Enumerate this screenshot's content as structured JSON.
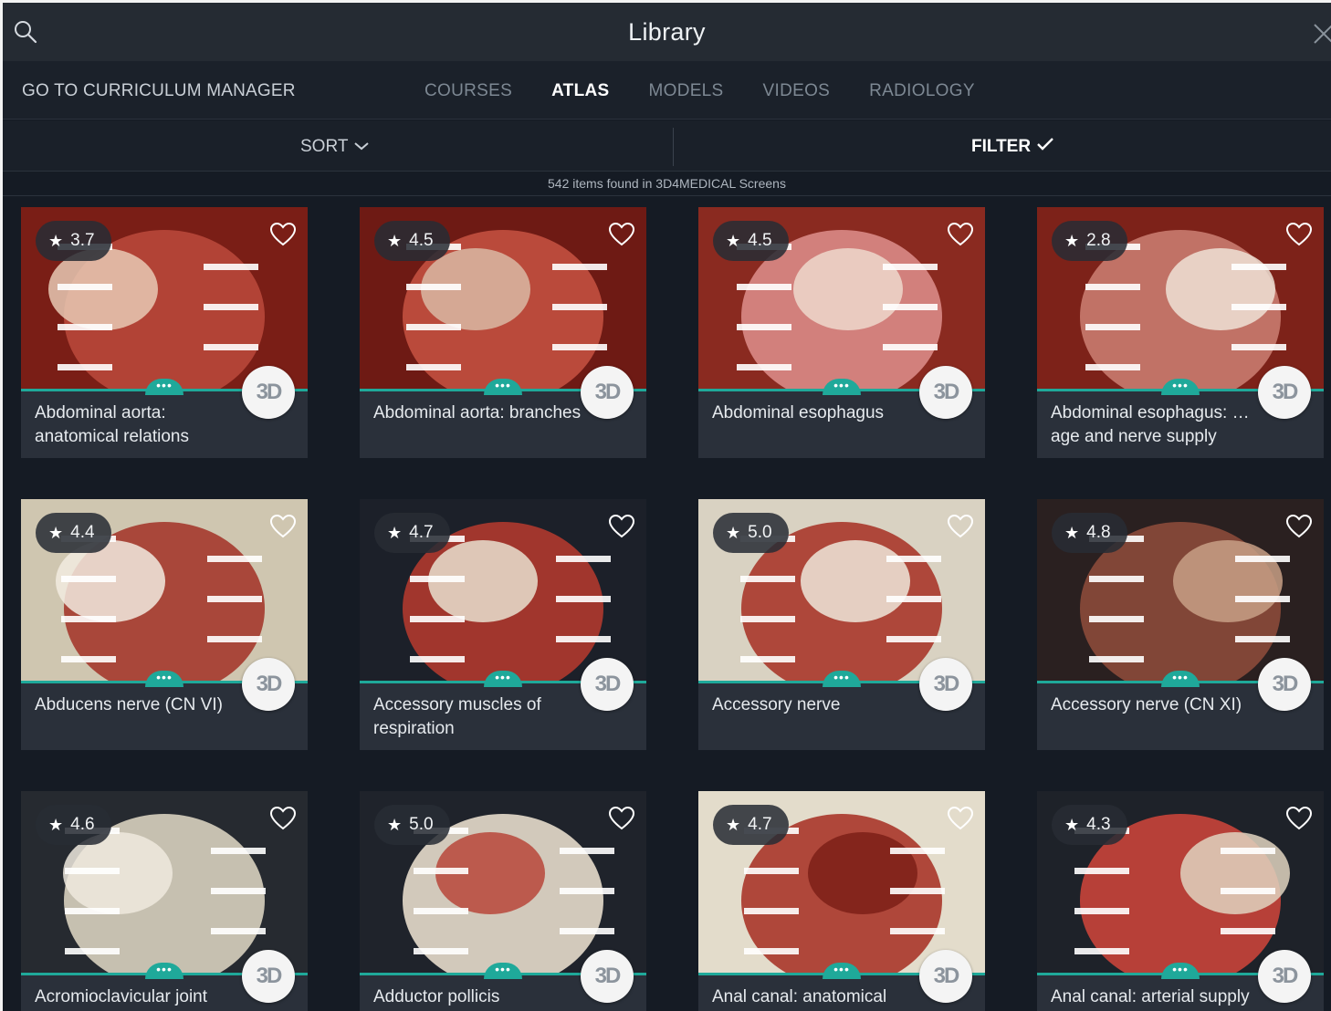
{
  "window": {
    "title": "Library"
  },
  "tabbar": {
    "curriculum_label": "GO TO CURRICULUM MANAGER",
    "tabs": [
      {
        "label": "COURSES",
        "active": false
      },
      {
        "label": "ATLAS",
        "active": true
      },
      {
        "label": "MODELS",
        "active": false
      },
      {
        "label": "VIDEOS",
        "active": false
      },
      {
        "label": "RADIOLOGY",
        "active": false
      }
    ]
  },
  "sortbar": {
    "sort_label": "SORT",
    "filter_label": "FILTER"
  },
  "results": {
    "count_text": "542 items found in 3D4MEDICAL Screens"
  },
  "badge_text": "3D",
  "icons": {
    "search": "search-icon",
    "close": "close-icon",
    "favorite": "heart-icon",
    "more": "more-dots-icon",
    "sort": "chevron-down-icon",
    "filter": "checkmark-icon"
  },
  "colors": {
    "accent": "#1fa99a",
    "background": "#151b24",
    "card": "#2a303a"
  },
  "cards": [
    {
      "rating": "3.7",
      "title": "Abdominal aorta: anatomical relations"
    },
    {
      "rating": "4.5",
      "title": "Abdominal aorta: branches"
    },
    {
      "rating": "4.5",
      "title": "Abdominal esophagus"
    },
    {
      "rating": "2.8",
      "title": "Abdominal esophagus: … age and nerve supply"
    },
    {
      "rating": "4.4",
      "title": "Abducens nerve (CN VI)"
    },
    {
      "rating": "4.7",
      "title": "Accessory muscles of respiration"
    },
    {
      "rating": "5.0",
      "title": "Accessory nerve"
    },
    {
      "rating": "4.8",
      "title": "Accessory nerve (CN XI)"
    },
    {
      "rating": "4.6",
      "title": "Acromioclavicular joint"
    },
    {
      "rating": "5.0",
      "title": "Adductor pollicis"
    },
    {
      "rating": "4.7",
      "title": "Anal canal: anatomical"
    },
    {
      "rating": "4.3",
      "title": "Anal canal: arterial supply"
    }
  ]
}
